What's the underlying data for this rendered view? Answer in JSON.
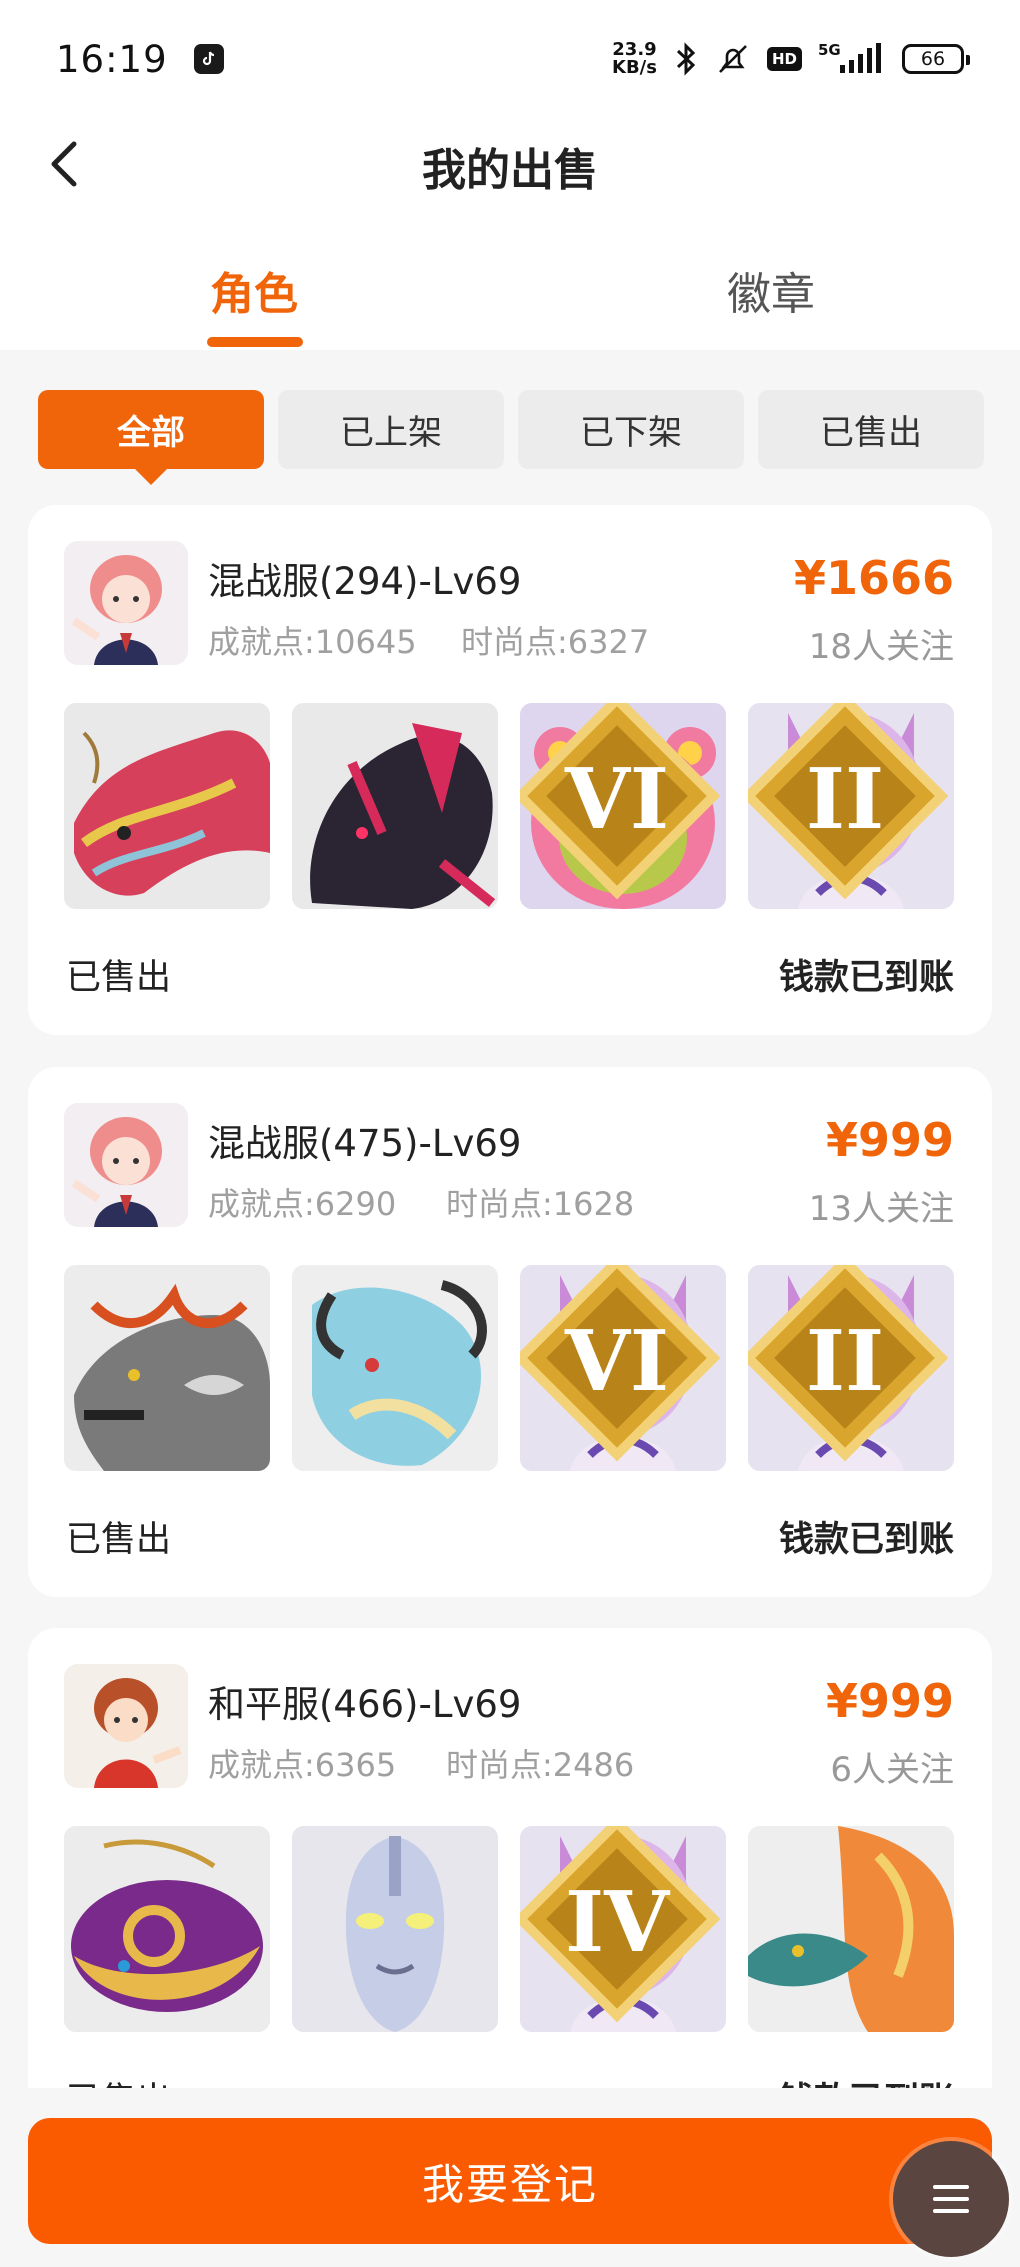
{
  "status_bar": {
    "time": "16:19",
    "net_speed_value": "23.9",
    "net_speed_unit": "KB/s",
    "hd": "HD",
    "signal": "5G",
    "battery": "66"
  },
  "header": {
    "title": "我的出售"
  },
  "tabs": [
    {
      "label": "角色",
      "active": true
    },
    {
      "label": "徽章",
      "active": false
    }
  ],
  "filters": [
    {
      "label": "全部",
      "active": true
    },
    {
      "label": "已上架",
      "active": false
    },
    {
      "label": "已下架",
      "active": false
    },
    {
      "label": "已售出",
      "active": false
    }
  ],
  "listings": [
    {
      "title": "混战服(294)-Lv69",
      "achievement": "成就点:10645",
      "fashion": "时尚点:6327",
      "price": "¥1666",
      "followers": "18人关注",
      "status": "已售出",
      "payment": "钱款已到账",
      "avatar": "pink-hair-girl",
      "items": [
        {
          "icon": "chinese-dragon",
          "rank": ""
        },
        {
          "icon": "dark-dragon",
          "rank": ""
        },
        {
          "icon": "pink-bear",
          "rank": "VI"
        },
        {
          "icon": "fox-girl",
          "rank": "II"
        }
      ]
    },
    {
      "title": "混战服(475)-Lv69",
      "achievement": "成就点:6290",
      "fashion": "时尚点:1628",
      "price": "¥999",
      "followers": "13人关注",
      "status": "已售出",
      "payment": "钱款已到账",
      "avatar": "pink-hair-girl",
      "items": [
        {
          "icon": "grey-dragon",
          "rank": ""
        },
        {
          "icon": "blue-dragon",
          "rank": ""
        },
        {
          "icon": "fox-girl",
          "rank": "VI"
        },
        {
          "icon": "fox-girl",
          "rank": "II"
        }
      ]
    },
    {
      "title": "和平服(466)-Lv69",
      "achievement": "成就点:6365",
      "fashion": "时尚点:2486",
      "price": "¥999",
      "followers": "6人关注",
      "status": "已售出",
      "payment": "钱款已到账",
      "avatar": "red-hair-boy",
      "items": [
        {
          "icon": "golden-whale",
          "rank": ""
        },
        {
          "icon": "silver-hero",
          "rank": ""
        },
        {
          "icon": "fox-girl",
          "rank": "IV"
        },
        {
          "icon": "orange-dragon",
          "rank": ""
        }
      ]
    }
  ],
  "bottom_button": {
    "label": "我要登记"
  },
  "colors": {
    "accent": "#f0640a",
    "button": "#fa5a00"
  }
}
